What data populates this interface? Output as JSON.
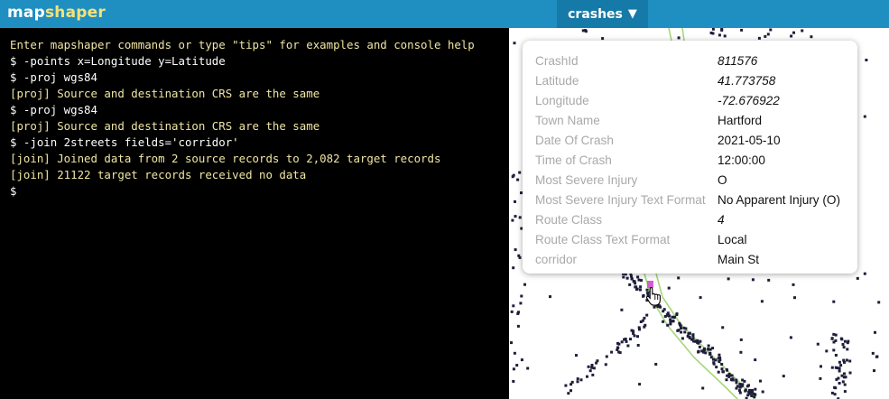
{
  "header": {
    "logo_part1": "map",
    "logo_part2": "shaper",
    "layer_name": "crashes",
    "layer_caret": "▼"
  },
  "console": {
    "lines": [
      {
        "type": "intro",
        "text": "Enter mapshaper commands or type \"tips\" for examples and console help"
      },
      {
        "type": "cmd",
        "text": "$ -points x=Longitude y=Latitude"
      },
      {
        "type": "cmd",
        "text": "$ -proj wgs84"
      },
      {
        "type": "msg",
        "text": "[proj] Source and destination CRS are the same"
      },
      {
        "type": "cmd",
        "text": "$ -proj wgs84"
      },
      {
        "type": "msg",
        "text": "[proj] Source and destination CRS are the same"
      },
      {
        "type": "cmd",
        "text": "$ -join 2streets fields='corridor'"
      },
      {
        "type": "msg",
        "text": "[join] Joined data from 2 source records to 2,082 target records"
      },
      {
        "type": "msg",
        "text": "[join] 21122 target records received no data"
      },
      {
        "type": "cmd",
        "text": "$"
      }
    ]
  },
  "popup": {
    "rows": [
      {
        "key": "CrashId",
        "value": "811576",
        "numeric": true
      },
      {
        "key": "Latitude",
        "value": "41.773758",
        "numeric": true
      },
      {
        "key": "Longitude",
        "value": "-72.676922",
        "numeric": true
      },
      {
        "key": "Town Name",
        "value": "Hartford",
        "numeric": false
      },
      {
        "key": "Date Of Crash",
        "value": "2021-05-10",
        "numeric": false
      },
      {
        "key": "Time of Crash",
        "value": "12:00:00",
        "numeric": false
      },
      {
        "key": "Most Severe Injury",
        "value": "O",
        "numeric": false
      },
      {
        "key": "Most Severe Injury Text Format",
        "value": "No Apparent Injury (O)",
        "numeric": false
      },
      {
        "key": "Route Class",
        "value": "4",
        "numeric": true
      },
      {
        "key": "Route Class Text Format",
        "value": "Local",
        "numeric": false
      },
      {
        "key": "corridor",
        "value": "Main St",
        "numeric": false
      }
    ]
  },
  "map": {
    "point_color": "#1e1e3a",
    "selected_point_color": "#d15fd0",
    "street_line_color": "#a6d77a",
    "icons": [
      "pointer-hand-icon"
    ]
  }
}
